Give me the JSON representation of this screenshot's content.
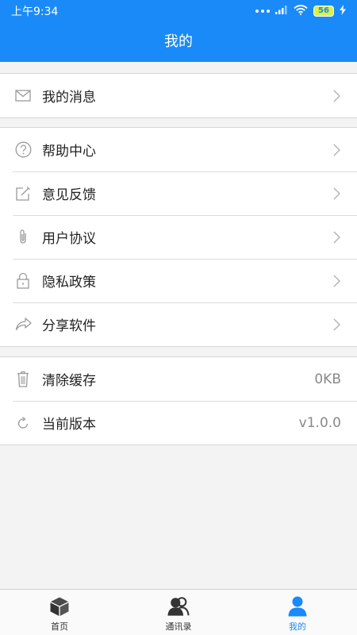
{
  "status_bar": {
    "time": "上午9:34",
    "battery": "56"
  },
  "header": {
    "title": "我的"
  },
  "sections": [
    {
      "items": [
        {
          "label": "我的消息",
          "icon": "mail-icon"
        }
      ]
    },
    {
      "items": [
        {
          "label": "帮助中心",
          "icon": "help-icon"
        },
        {
          "label": "意见反馈",
          "icon": "edit-icon"
        },
        {
          "label": "用户协议",
          "icon": "paperclip-icon"
        },
        {
          "label": "隐私政策",
          "icon": "lock-icon"
        },
        {
          "label": "分享软件",
          "icon": "share-icon"
        }
      ]
    },
    {
      "items": [
        {
          "label": "清除缓存",
          "icon": "trash-icon",
          "value": "0KB"
        },
        {
          "label": "当前版本",
          "icon": "refresh-icon",
          "value": "v1.0.0"
        }
      ]
    }
  ],
  "tabbar": {
    "tabs": [
      {
        "label": "首页",
        "icon": "cube-icon",
        "active": false
      },
      {
        "label": "通讯录",
        "icon": "contacts-icon",
        "active": false
      },
      {
        "label": "我的",
        "icon": "user-icon",
        "active": true
      }
    ]
  },
  "colors": {
    "accent": "#1a8af8",
    "background": "#f3f3f3",
    "icon_gray": "#9a9a9a"
  }
}
